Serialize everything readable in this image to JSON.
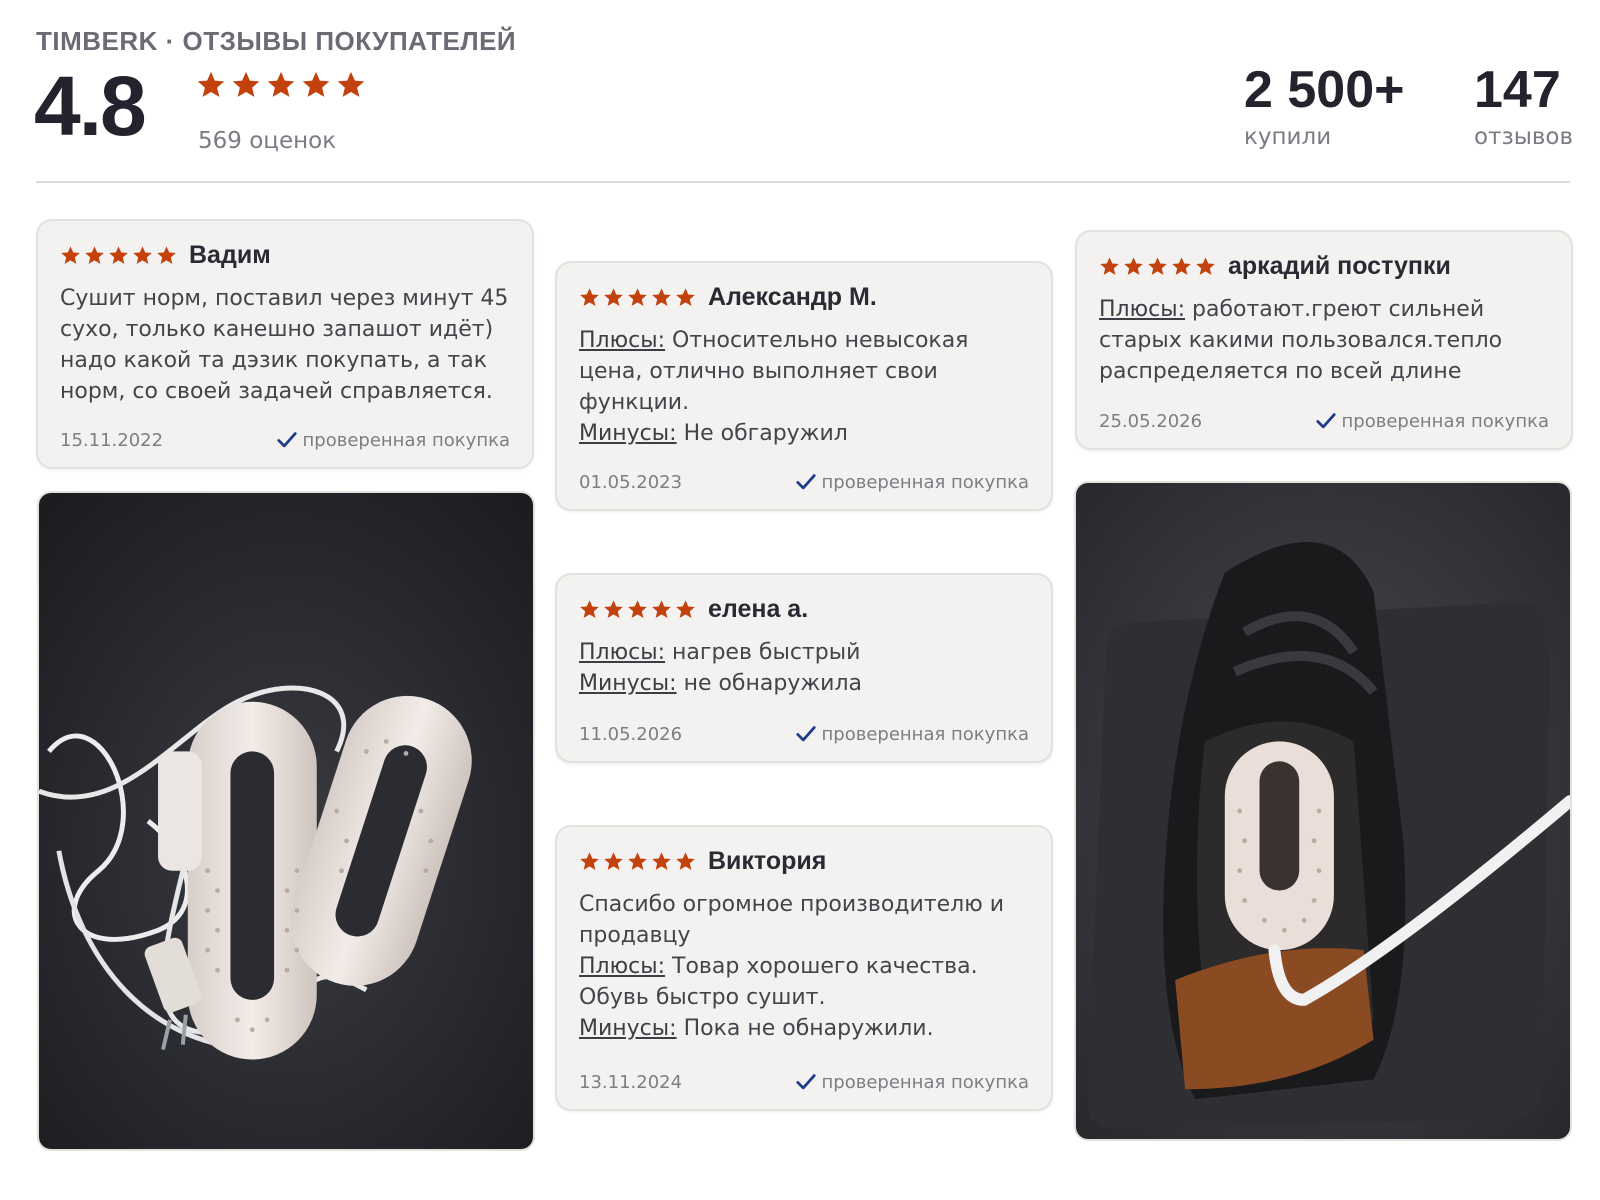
{
  "header": {
    "brand": "TIMBERK · ОТЗЫВЫ ПОКУПАТЕЛЕЙ",
    "rating": "4.8",
    "rating_count": "569 оценок",
    "bought_value": "2 500+",
    "bought_label": "купили",
    "reviews_value": "147",
    "reviews_label": "отзывов",
    "star_color": "#c2410c"
  },
  "labels": {
    "pros": "Плюсы:",
    "cons": "Минусы:",
    "verified": "проверенная покупка"
  },
  "reviews": [
    {
      "author": "Вадим",
      "stars": 5,
      "text": "Сушит норм, поставил через минут 45 сухо, только канешно запашот идёт) надо какой та дэзик покупать, а так норм, со своей задачей справляется.",
      "date": "15.11.2022"
    },
    {
      "author": "Александр М.",
      "stars": 5,
      "pros": "Относительно невысокая цена, отлично выполняет свои функции.",
      "cons": "Не обгаружил",
      "date": "01.05.2023"
    },
    {
      "author": "елена а.",
      "stars": 5,
      "pros": "нагрев быстрый",
      "cons": "не обнаружила",
      "date": "11.05.2026"
    },
    {
      "author": "Виктория",
      "stars": 5,
      "text": "Спасибо огромное производителю и продавцу",
      "pros": "Товар хорошего качества. Обувь быстро сушит.",
      "cons": "Пока не обнаружили.",
      "date": "13.11.2024"
    },
    {
      "author": "аркадий поступки",
      "stars": 5,
      "pros": "работают.греют сильней старых какими пользовался.тепло распределяется по всей длине",
      "date": "25.05.2026"
    }
  ],
  "photos": [
    {
      "subject": "shoe-dryer-product-photo"
    },
    {
      "subject": "shoe-dryer-in-shoe-photo"
    }
  ]
}
